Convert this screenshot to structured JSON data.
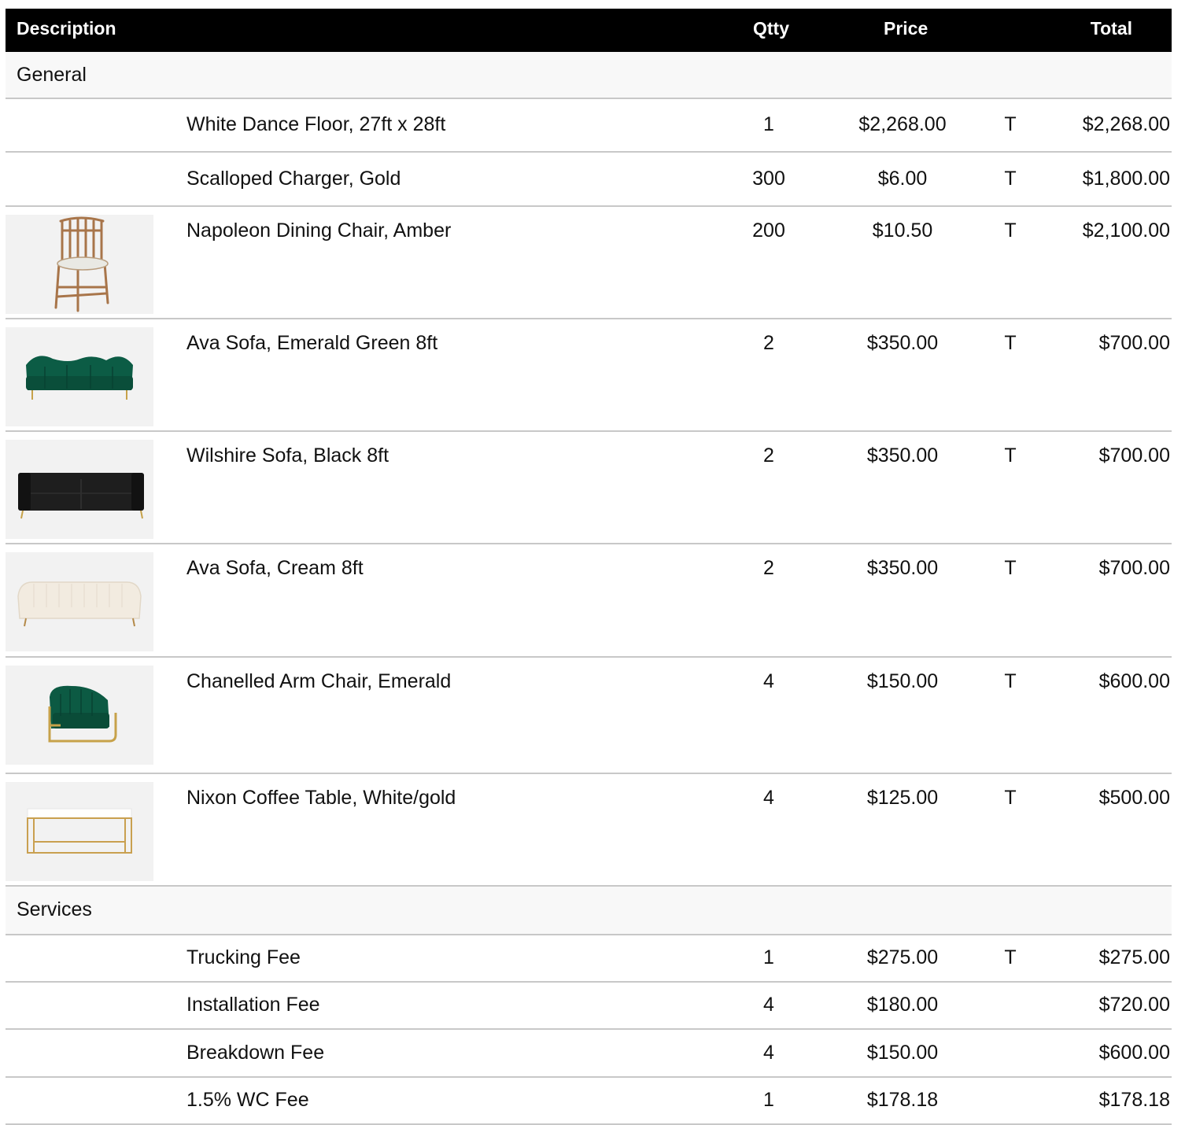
{
  "header": {
    "description": "Description",
    "qtty": "Qtty",
    "price": "Price",
    "total": "Total"
  },
  "sections": [
    {
      "name": "General",
      "items": [
        {
          "description": "White Dance Floor, 27ft x 28ft",
          "qtty": "1",
          "price": "$2,268.00",
          "tax": "T",
          "total": "$2,268.00",
          "image": ""
        },
        {
          "description": "Scalloped Charger, Gold",
          "qtty": "300",
          "price": "$6.00",
          "tax": "T",
          "total": "$1,800.00",
          "image": ""
        },
        {
          "description": "Napoleon Dining Chair, Amber",
          "qtty": "200",
          "price": "$10.50",
          "tax": "T",
          "total": "$2,100.00",
          "image": "napoleon-chair"
        },
        {
          "description": "Ava Sofa, Emerald Green 8ft",
          "qtty": "2",
          "price": "$350.00",
          "tax": "T",
          "total": "$700.00",
          "image": "emerald-sofa"
        },
        {
          "description": "Wilshire Sofa, Black 8ft",
          "qtty": "2",
          "price": "$350.00",
          "tax": "T",
          "total": "$700.00",
          "image": "black-sofa"
        },
        {
          "description": "Ava Sofa, Cream 8ft",
          "qtty": "2",
          "price": "$350.00",
          "tax": "T",
          "total": "$700.00",
          "image": "cream-sofa"
        },
        {
          "description": "Chanelled Arm Chair, Emerald",
          "qtty": "4",
          "price": "$150.00",
          "tax": "T",
          "total": "$600.00",
          "image": "emerald-armchair"
        },
        {
          "description": "Nixon Coffee Table, White/gold",
          "qtty": "4",
          "price": "$125.00",
          "tax": "T",
          "total": "$500.00",
          "image": "coffee-table"
        }
      ]
    },
    {
      "name": "Services",
      "items": [
        {
          "description": "Trucking Fee",
          "qtty": "1",
          "price": "$275.00",
          "tax": "T",
          "total": "$275.00",
          "image": ""
        },
        {
          "description": "Installation Fee",
          "qtty": "4",
          "price": "$180.00",
          "tax": "",
          "total": "$720.00",
          "image": ""
        },
        {
          "description": "Breakdown Fee",
          "qtty": "4",
          "price": "$150.00",
          "tax": "",
          "total": "$600.00",
          "image": ""
        },
        {
          "description": "1.5% WC Fee",
          "qtty": "1",
          "price": "$178.18",
          "tax": "",
          "total": "$178.18",
          "image": ""
        }
      ]
    }
  ]
}
